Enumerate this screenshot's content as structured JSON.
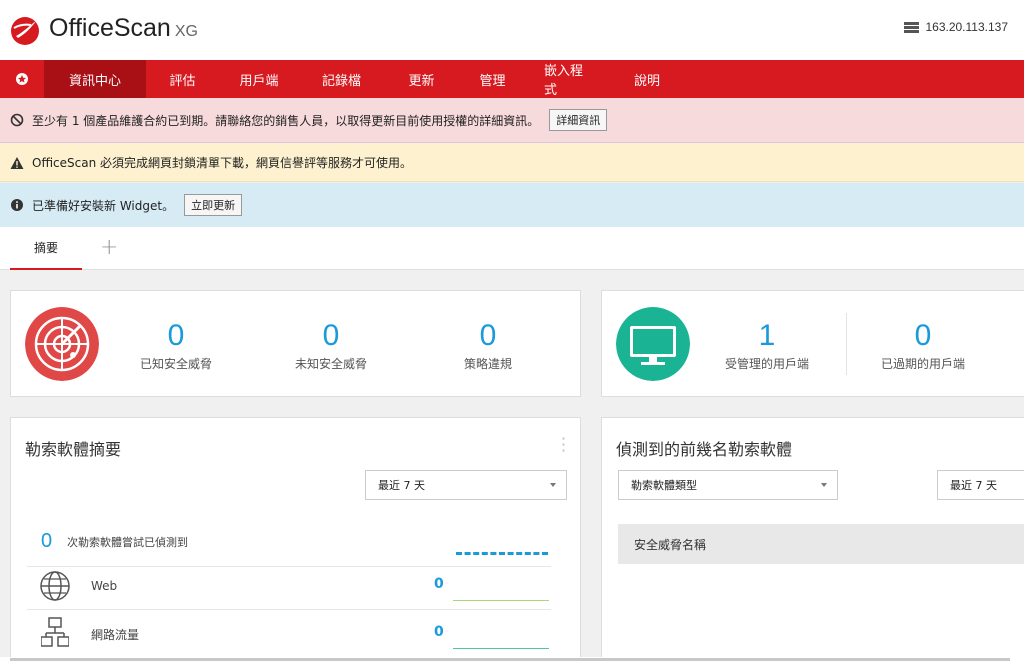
{
  "header": {
    "brand": "OfficeScan",
    "brand_suffix": "XG",
    "server_ip": "163.20.113.137"
  },
  "nav": {
    "items": [
      {
        "label": "資訊中心",
        "active": true
      },
      {
        "label": "評估"
      },
      {
        "label": "用戶端"
      },
      {
        "label": "記錄檔"
      },
      {
        "label": "更新"
      },
      {
        "label": "管理"
      },
      {
        "label": "嵌入程式"
      },
      {
        "label": "說明"
      }
    ]
  },
  "alerts": {
    "license": {
      "text": "至少有 1 個產品維護合約已到期。請聯絡您的銷售人員，以取得更新目前使用授權的詳細資訊。",
      "button": "詳細資訊"
    },
    "warning": {
      "text": "OfficeScan 必須完成網頁封鎖清單下載，網頁信譽評等服務才可使用。"
    },
    "widget": {
      "text": "已準備好安裝新 Widget。",
      "button": "立即更新"
    }
  },
  "tabs": {
    "active": "摘要",
    "add": "+"
  },
  "threats_card": {
    "known": {
      "value": "0",
      "label": "已知安全威脅"
    },
    "unknown": {
      "value": "0",
      "label": "未知安全威脅"
    },
    "policy": {
      "value": "0",
      "label": "策略違規"
    }
  },
  "clients_card": {
    "managed": {
      "value": "1",
      "label": "受管理的用戶端"
    },
    "outdated": {
      "value": "0",
      "label": "已過期的用戶端"
    }
  },
  "ransomware_summary": {
    "title": "勒索軟體摘要",
    "period": "最近 7 天",
    "detected_count": "0",
    "detected_label": "次勒索軟體嘗試已偵測到",
    "rows": [
      {
        "label": "Web",
        "value": "0"
      },
      {
        "label": "網路流量",
        "value": "0"
      }
    ]
  },
  "top_ransomware": {
    "title": "偵測到的前幾名勒索軟體",
    "type_select": "勒索軟體類型",
    "period": "最近 7 天",
    "column_header": "安全威脅名稱"
  },
  "colors": {
    "brand_red": "#d71920",
    "nav_active": "#a91016",
    "accent_blue": "#199bd9",
    "threat_red": "#e04848",
    "client_green": "#1ab394"
  }
}
